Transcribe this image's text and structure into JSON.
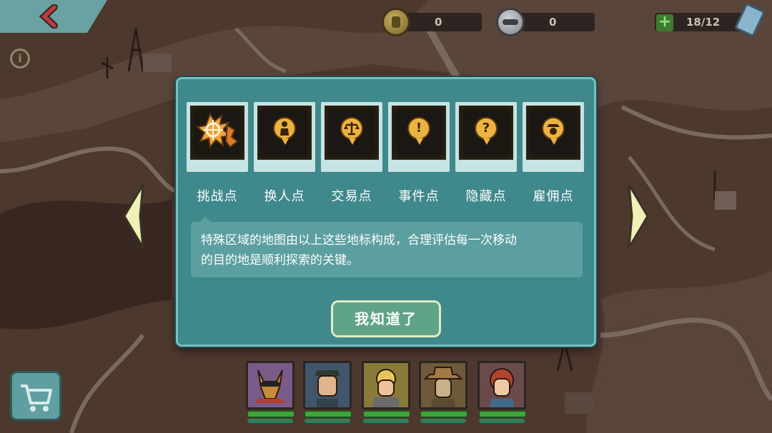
{
  "topbar": {
    "caps_value": "0",
    "tokens_value": "0",
    "dwellers_count": "18/12"
  },
  "dialog": {
    "landmarks": [
      {
        "label": "挑战点",
        "icon": "challenge-icon"
      },
      {
        "label": "换人点",
        "icon": "person-swap-icon"
      },
      {
        "label": "交易点",
        "icon": "scale-icon"
      },
      {
        "label": "事件点",
        "icon": "exclamation-icon"
      },
      {
        "label": "隐藏点",
        "icon": "question-icon"
      },
      {
        "label": "雇佣点",
        "icon": "hire-icon"
      }
    ],
    "description_line1": "特殊区域的地图由以上这些地标构成，合理评估每一次移动",
    "description_line2": "的目的地是顺利探索的关键。",
    "confirm_label": "我知道了"
  },
  "colors": {
    "dialog_bg": "#3f888b",
    "dialog_border": "#77bfc2",
    "pin_gold": "#ecb33e",
    "button_green": "#5fa487",
    "arrow_cream": "#eef0b8"
  },
  "team": [
    {
      "name": "dog-companion",
      "color": "#7a5a86"
    },
    {
      "name": "soldier",
      "color": "#42556a"
    },
    {
      "name": "blonde-dweller",
      "color": "#8a7a3a"
    },
    {
      "name": "cowboy",
      "color": "#6e5a3a"
    },
    {
      "name": "redhead",
      "color": "#6a4a4a"
    }
  ]
}
